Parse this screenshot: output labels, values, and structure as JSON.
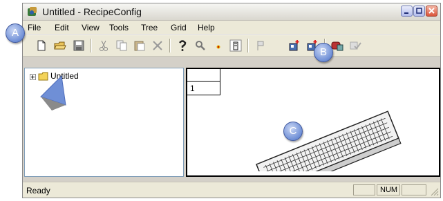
{
  "window": {
    "title": "Untitled - RecipeConfig"
  },
  "menu": [
    {
      "label": "File"
    },
    {
      "label": "Edit"
    },
    {
      "label": "View"
    },
    {
      "label": "Tools"
    },
    {
      "label": "Tree"
    },
    {
      "label": "Grid"
    },
    {
      "label": "Help"
    }
  ],
  "toolbar_icons": [
    "new-document-icon",
    "open-folder-icon",
    "save-icon",
    "cut-icon",
    "copy-icon",
    "paste-icon",
    "delete-icon",
    "help-icon",
    "find-icon",
    "marker-icon",
    "edit-page-icon",
    "flag-icon",
    "add-module-icon",
    "add-module-2-icon",
    "device-icon",
    "check-icon"
  ],
  "tree": {
    "root_label": "Untitled"
  },
  "grid": {
    "row_number": "1"
  },
  "status": {
    "text": "Ready",
    "num_label": "NUM"
  },
  "callouts": {
    "a": "A",
    "b": "B",
    "c": "C"
  }
}
